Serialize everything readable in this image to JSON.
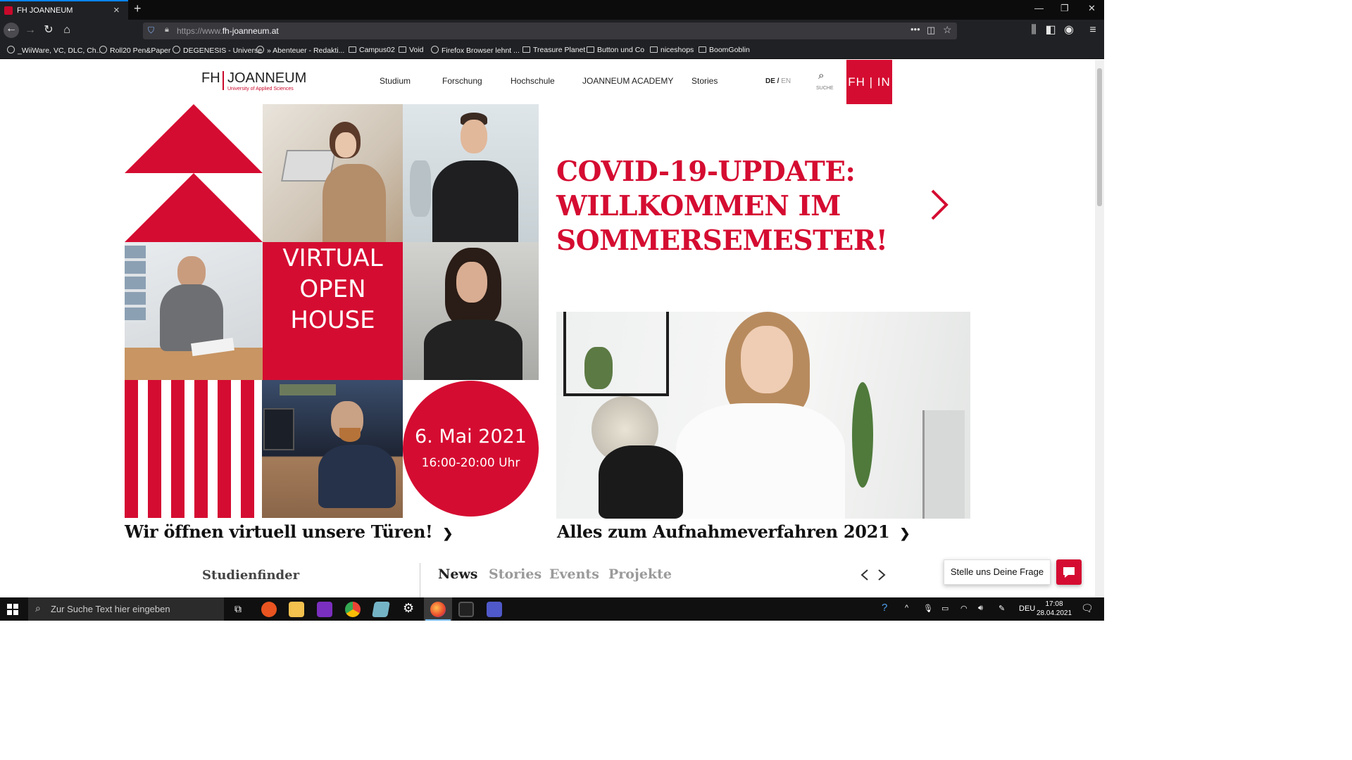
{
  "browser": {
    "tab_title": "FH JOANNEUM",
    "url_prefix": "https://www.",
    "url_domain": "fh-joanneum.at",
    "bookmarks": [
      {
        "label": "_WiiWare, VC, DLC, Ch...",
        "icon": "globe-icon"
      },
      {
        "label": "Roll20 Pen&Paper",
        "icon": "globe-icon"
      },
      {
        "label": "DEGENESIS - Universe",
        "icon": "globe-icon"
      },
      {
        "label": "» Abenteuer - Redakti...",
        "icon": "globe-icon"
      },
      {
        "label": "Campus02",
        "icon": "folder-icon"
      },
      {
        "label": "Void",
        "icon": "folder-icon"
      },
      {
        "label": "Firefox Browser lehnt ...",
        "icon": "globe-icon"
      },
      {
        "label": "Treasure Planet",
        "icon": "folder-icon"
      },
      {
        "label": "Button und Co",
        "icon": "folder-icon"
      },
      {
        "label": "niceshops",
        "icon": "folder-icon"
      },
      {
        "label": "BoomGoblin",
        "icon": "folder-icon"
      }
    ]
  },
  "site": {
    "logo": {
      "name": "FH JOANNEUM",
      "fh": "FH",
      "joanneum": "JOANNEUM",
      "subtitle": "University of Applied Sciences"
    },
    "menu": [
      "Studium",
      "Forschung",
      "Hochschule",
      "JOANNEUM ACADEMY",
      "Stories"
    ],
    "lang_de": "DE",
    "lang_sep": " / ",
    "lang_en": "EN",
    "search_label": "SUCHE",
    "fhin": "FH | IN"
  },
  "hero": {
    "virtual_open_house": [
      "VIRTUAL",
      "OPEN",
      "HOUSE"
    ],
    "date": "6. Mai 2021",
    "time": "16:00-20:00 Uhr",
    "left_caption": "Wir öffnen virtuell unsere Türen!",
    "covid_headline": [
      "COVID-19-UPDATE:",
      "WILLKOMMEN IM",
      "SOMMERSEMESTER!"
    ],
    "right_caption": "Alles zum Aufnahmeverfahren 2021",
    "accent_color": "#d50c31"
  },
  "bottom": {
    "studienfinder": "Studienfinder",
    "tabs": [
      "News",
      "Stories",
      "Events",
      "Projekte"
    ],
    "active_tab": "News"
  },
  "chat": {
    "label": "Stelle uns Deine Frage"
  },
  "taskbar": {
    "search_placeholder": "Zur Suche Text hier eingeben",
    "language": "DEU",
    "time": "17:08",
    "date": "28.04.2021"
  }
}
